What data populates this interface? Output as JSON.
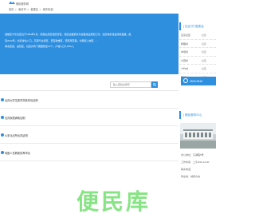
{
  "site": {
    "name": "便民服务网"
  },
  "breadcrumb": [
    "首页",
    "南京市",
    "鼓楼区",
    "城东街道"
  ],
  "intro": {
    "lines": [
      "鼓楼区宁东社区位于1984年1月，原属玄武区辖区管辖，辖区总面积约为道路建设规划工作，社区城市建设持续发展。截",
      "至2012年，社区常住人口，东部与玄武区，西至鼓楼区，南至雨花路，北部接上城区……",
      "城北街道，是辖区，社区共有下属居民区12个。户籍人口6,245人。"
    ]
  },
  "search": {
    "placeholder": "输入查找关键字"
  },
  "notices": [
    {
      "title": "出具大学生助学贷款申请证明"
    },
    {
      "title": "出具家属病故证明"
    },
    {
      "title": "公安派出所出具证明"
    },
    {
      "title": "特困人员救助供养申请"
    }
  ],
  "sidebar": {
    "heading": "| 社区/村·居委会",
    "rows": [
      {
        "left": "瓦东社区",
        "right": "社区"
      },
      {
        "left": "桥路村",
        "right": "社区"
      },
      {
        "left": "中坝村",
        "right": "社区"
      },
      {
        "left": "大营村",
        "right": "社区"
      },
      {
        "left": "十竹村",
        "right": "社区"
      },
      {
        "left": "南堡村",
        "right": "社区"
      }
    ]
  },
  "phone": {
    "number": "0523-8315"
  },
  "service": {
    "heading": "| 便民服务中心",
    "info": [
      "办公地址：东湖路5号",
      "工作时间：上午8:00-12:00",
      "联系电话：",
      "所在地：城南方向"
    ]
  },
  "watermark": {
    "text": "便民库"
  },
  "colors": {
    "accent": "#2f8fdf",
    "watermark": "#7de27a"
  }
}
